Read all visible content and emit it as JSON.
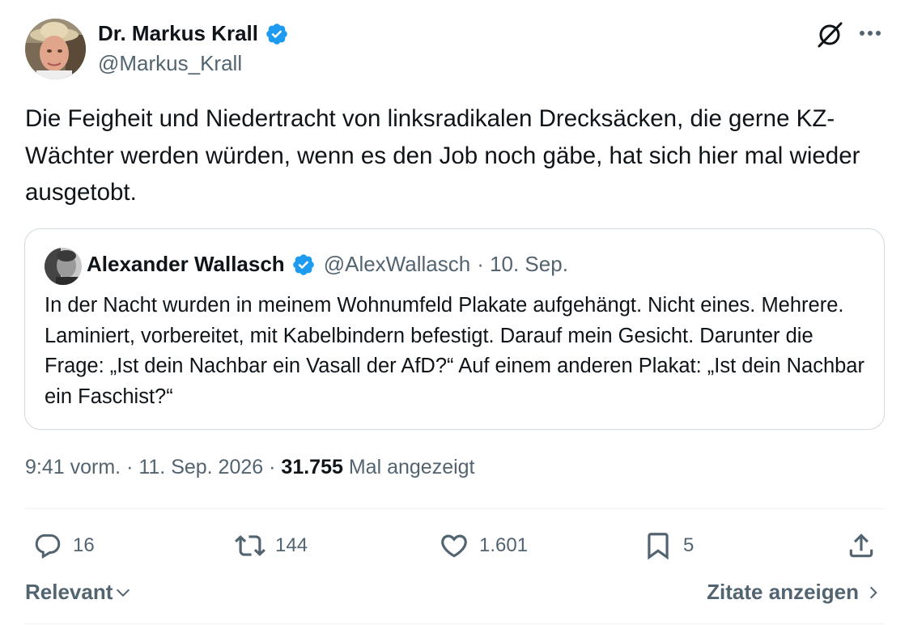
{
  "author": {
    "name": "Dr. Markus Krall",
    "handle": "@Markus_Krall",
    "verified": true,
    "avatar": "profile-photo-man-with-hat"
  },
  "header_icons": [
    "grok-icon",
    "more-icon"
  ],
  "tweet": {
    "text": "Die Feigheit und Niedertracht von linksradikalen Drecksäcken, die gerne KZ-Wächter werden würden, wenn es den Job noch gäbe, hat sich hier mal wieder ausgetobt."
  },
  "quote": {
    "name": "Alexander Wallasch",
    "handle": "@AlexWallasch",
    "date": "· 10. Sep.",
    "verified": true,
    "text": "In der Nacht wurden in meinem Wohnumfeld Plakate aufgehängt. Nicht eines. Mehrere. Laminiert, vorbereitet, mit Kabelbindern befestigt. Darauf mein Gesicht. Darunter die Frage: „Ist dein Nachbar ein Vasall der AfD?“ Auf einem anderen Plakat: „Ist dein Nachbar ein Faschist?“"
  },
  "meta": {
    "time": "9:41 vorm.",
    "date": "11. Sep. 2026",
    "views": "31.755",
    "views_label": "Mal angezeigt"
  },
  "actions": {
    "replies": "16",
    "reposts": "144",
    "likes": "1.601",
    "bookmarks": "5"
  },
  "footer": {
    "sort_label": "Relevant",
    "quotes_label": "Zitate anzeigen"
  },
  "colors": {
    "text": "#0f1419",
    "secondary": "#536471",
    "verified": "#1d9bf0",
    "border": "#cfd9de",
    "divider": "#eff3f4"
  }
}
